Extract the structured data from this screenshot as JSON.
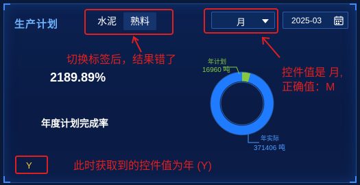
{
  "panel": {
    "title": "生产计划"
  },
  "tabs": [
    {
      "label": "水泥",
      "active": false
    },
    {
      "label": "熟料",
      "active": true
    }
  ],
  "period_select": {
    "value": "月"
  },
  "date_picker": {
    "value": "2025-03"
  },
  "metric": {
    "value": "2189.89%",
    "label": "年度计划完成率"
  },
  "chart_data": {
    "type": "pie",
    "categories": [
      "年计划",
      "年实际"
    ],
    "values": [
      16960,
      371406
    ],
    "units": "吨",
    "plan_label": "年计划",
    "plan_value": "16960 吨",
    "actual_label": "年实际",
    "actual_value": "371406 吨"
  },
  "selected_value": {
    "text": "Y"
  },
  "annotations": {
    "tab_switch": "切换标签后，结果错了",
    "control_value_line1": "控件值是 月,",
    "control_value_line2": "正确值：M",
    "current_value": "此时获取到的控件值为年 (Y)"
  },
  "colors": {
    "background": "#0a1b45",
    "accent": "#3f8cff",
    "annotation_red": "#e02020",
    "plan_green": "#86c940",
    "actual_blue": "#1f7bff",
    "selected_yellow": "#ffcc33"
  },
  "icons": {
    "date_picker": "calendar-icon",
    "select": "caret-down-icon"
  }
}
